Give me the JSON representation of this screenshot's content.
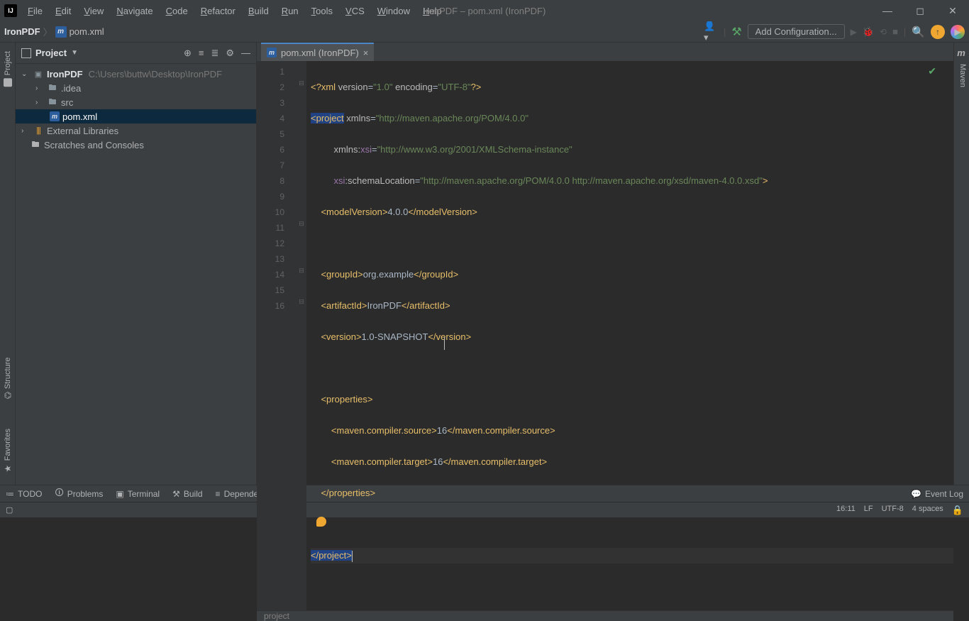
{
  "window": {
    "title": "IronPDF – pom.xml (IronPDF)"
  },
  "menu": [
    "File",
    "Edit",
    "View",
    "Navigate",
    "Code",
    "Refactor",
    "Build",
    "Run",
    "Tools",
    "VCS",
    "Window",
    "Help"
  ],
  "breadcrumb": {
    "root": "IronPDF",
    "file": "pom.xml"
  },
  "toolbar": {
    "addConfiguration": "Add Configuration..."
  },
  "projectPanel": {
    "title": "Project",
    "tree": {
      "root": {
        "name": "IronPDF",
        "path": "C:\\Users\\buttw\\Desktop\\IronPDF"
      },
      "idea": ".idea",
      "src": "src",
      "pom": "pom.xml",
      "external": "External Libraries",
      "scratches": "Scratches and Consoles"
    }
  },
  "leftTabs": {
    "project": "Project",
    "structure": "Structure",
    "favorites": "Favorites"
  },
  "rightTabs": {
    "maven": "Maven"
  },
  "editor": {
    "tabName": "pom.xml (IronPDF)",
    "breadcrumb": "project",
    "caretLineCol": "16:11",
    "lineSep": "LF",
    "encoding": "UTF-8",
    "indent": "4 spaces",
    "lines": [
      {
        "n": 1,
        "raw": "<?xml version=\"1.0\" encoding=\"UTF-8\"?>"
      },
      {
        "n": 2,
        "raw": "<project xmlns=\"http://maven.apache.org/POM/4.0.0\""
      },
      {
        "n": 3,
        "raw": "         xmlns:xsi=\"http://www.w3.org/2001/XMLSchema-instance\""
      },
      {
        "n": 4,
        "raw": "         xsi:schemaLocation=\"http://maven.apache.org/POM/4.0.0 http://maven.apache.org/xsd/maven-4.0.0.xsd\">"
      },
      {
        "n": 5,
        "raw": "    <modelVersion>4.0.0</modelVersion>"
      },
      {
        "n": 6,
        "raw": ""
      },
      {
        "n": 7,
        "raw": "    <groupId>org.example</groupId>"
      },
      {
        "n": 8,
        "raw": "    <artifactId>IronPDF</artifactId>"
      },
      {
        "n": 9,
        "raw": "    <version>1.0-SNAPSHOT</version>"
      },
      {
        "n": 10,
        "raw": ""
      },
      {
        "n": 11,
        "raw": "    <properties>"
      },
      {
        "n": 12,
        "raw": "        <maven.compiler.source>16</maven.compiler.source>"
      },
      {
        "n": 13,
        "raw": "        <maven.compiler.target>16</maven.compiler.target>"
      },
      {
        "n": 14,
        "raw": "    </properties>"
      },
      {
        "n": 15,
        "raw": ""
      },
      {
        "n": 16,
        "raw": "</project>"
      }
    ]
  },
  "bottomTabs": {
    "todo": "TODO",
    "problems": "Problems",
    "terminal": "Terminal",
    "build": "Build",
    "dependencies": "Dependencies",
    "eventlog": "Event Log"
  }
}
